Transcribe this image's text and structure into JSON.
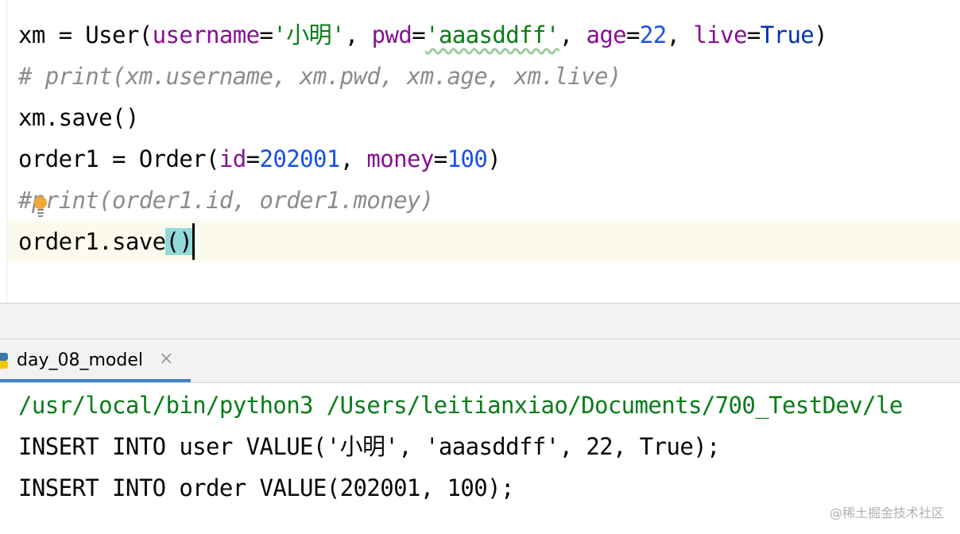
{
  "editor": {
    "line1": {
      "var": "xm = User(",
      "k_username": "username",
      "eq1": "=",
      "v_username": "'小明'",
      "sep1": ", ",
      "k_pwd": "pwd",
      "eq2": "=",
      "v_pwd": "'aaasddff'",
      "sep2": ", ",
      "k_age": "age",
      "eq3": "=",
      "v_age": "22",
      "sep3": ", ",
      "k_live": "live",
      "eq4": "=",
      "v_live": "True",
      "close": ")"
    },
    "line2": "# print(xm.username, xm.pwd, xm.age, xm.live)",
    "line3": "xm.save()",
    "line4": {
      "var": "order1 = Order(",
      "k_id": "id",
      "eq1": "=",
      "v_id": "202001",
      "sep1": ", ",
      "k_money": "money",
      "eq2": "=",
      "v_money": "100",
      "close": ")"
    },
    "line5": "#print(order1.id, order1.money)",
    "line6": {
      "text": "order1.save",
      "brace": "()"
    },
    "bulb_icon": "lightbulb-icon"
  },
  "run": {
    "tab_label": "day_08_model",
    "tab_icon": "python-icon",
    "close_icon": "close-icon",
    "close_glyph": "×"
  },
  "console": {
    "line1": "/usr/local/bin/python3 /Users/leitianxiao/Documents/700_TestDev/le",
    "line2": "INSERT INTO user VALUE('小明', 'aaasddff', 22, True);",
    "line3": "INSERT INTO order VALUE(202001, 100);"
  },
  "watermark": "@稀土掘金技术社区",
  "colors": {
    "keyword_arg": "#871094",
    "string": "#067d17",
    "number": "#1750eb",
    "builtin": "#0033b3",
    "comment": "#8c8c8c",
    "brace_highlight": "#93d9d9",
    "current_line": "#fcfaed",
    "tab_underline": "#4083c9"
  }
}
